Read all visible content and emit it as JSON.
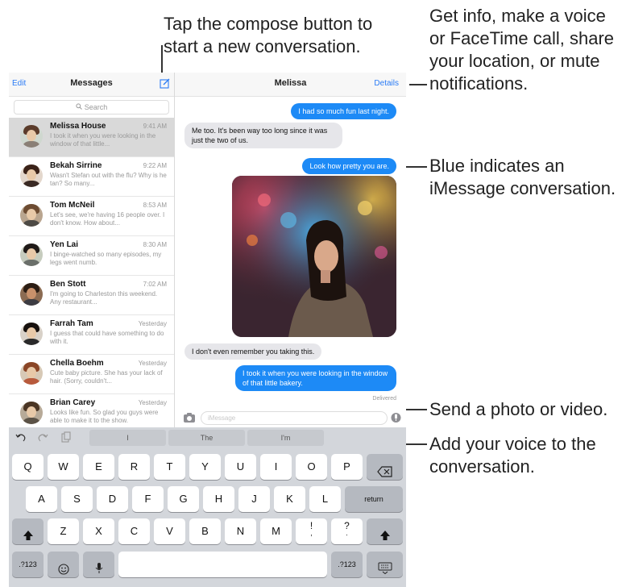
{
  "callouts": {
    "compose": "Tap the compose button to\nstart a new conversation.",
    "details": "Get info, make a voice\nor FaceTime call, share\nyour location, or mute\nnotifications.",
    "blue": "Blue indicates an\niMessage conversation.",
    "photo": "Send a photo or video.",
    "voice": "Add your voice to the\nconversation."
  },
  "sidebar": {
    "edit": "Edit",
    "title": "Messages",
    "compose_icon": "compose-icon",
    "search_placeholder": "Search",
    "items": [
      {
        "name": "Melissa House",
        "time": "9:41 AM",
        "preview": "I took it when you were looking in the window of that little...",
        "selected": true
      },
      {
        "name": "Bekah Sirrine",
        "time": "9:22 AM",
        "preview": "Wasn't Stefan out with the flu? Why is he tan? So many..."
      },
      {
        "name": "Tom McNeil",
        "time": "8:53 AM",
        "preview": "Let's see, we're having 16 people over. I don't know. How about..."
      },
      {
        "name": "Yen Lai",
        "time": "8:30 AM",
        "preview": "I binge-watched so many episodes, my legs went numb."
      },
      {
        "name": "Ben Stott",
        "time": "7:02 AM",
        "preview": "I'm going to Charleston this weekend. Any restaurant..."
      },
      {
        "name": "Farrah Tam",
        "time": "Yesterday",
        "preview": "I guess that could have something to do with it."
      },
      {
        "name": "Chella Boehm",
        "time": "Yesterday",
        "preview": "Cute baby picture. She has your lack of hair. (Sorry, couldn't..."
      },
      {
        "name": "Brian Carey",
        "time": "Yesterday",
        "preview": "Looks like fun. So glad you guys were able to make it to the show."
      }
    ]
  },
  "conversation": {
    "title": "Melissa",
    "details": "Details",
    "messages": [
      {
        "text": "I had so much fun last night.",
        "dir": "out"
      },
      {
        "text": "Me too. It's been way too long since it was just the two of us.",
        "dir": "in"
      },
      {
        "text": "Look how pretty you are.",
        "dir": "out"
      },
      {
        "text": "I don't even remember you taking this.",
        "dir": "in"
      },
      {
        "text": "I took it when you were looking in the window of that little bakery.",
        "dir": "out"
      }
    ],
    "delivered": "Delivered",
    "input_placeholder": "iMessage"
  },
  "keyboard": {
    "suggestions": [
      "I",
      "The",
      "I'm"
    ],
    "row1": [
      "Q",
      "W",
      "E",
      "R",
      "T",
      "Y",
      "U",
      "I",
      "O",
      "P"
    ],
    "row2": [
      "A",
      "S",
      "D",
      "F",
      "G",
      "H",
      "J",
      "K",
      "L"
    ],
    "row3": [
      "Z",
      "X",
      "C",
      "V",
      "B",
      "N",
      "M"
    ],
    "return": "return",
    "numbers": ".?123",
    "excl": {
      "top": "!",
      "bottom": ","
    },
    "quest": {
      "top": "?",
      "bottom": "."
    }
  },
  "colors": {
    "imessage_blue": "#1d8af6",
    "link_blue": "#2a7bf5",
    "keyboard_bg": "#d3d6db"
  }
}
